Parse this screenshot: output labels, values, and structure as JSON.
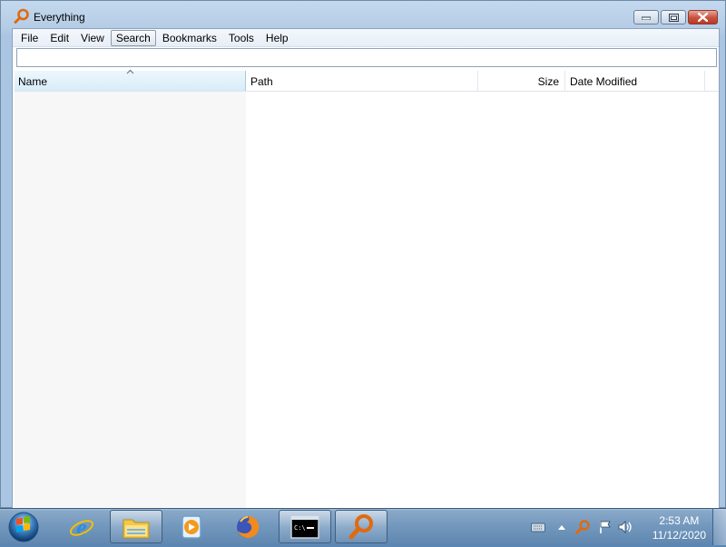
{
  "window": {
    "title": "Everything",
    "icon": "magnifier-icon"
  },
  "menu": {
    "items": [
      "File",
      "Edit",
      "View",
      "Search",
      "Bookmarks",
      "Tools",
      "Help"
    ],
    "active": "Search"
  },
  "search": {
    "value": "",
    "placeholder": ""
  },
  "list": {
    "columns": {
      "name": "Name",
      "path": "Path",
      "size": "Size",
      "date_modified": "Date Modified"
    },
    "sort_column": "name",
    "sort_direction": "ascending",
    "rows": []
  },
  "taskbar": {
    "start_icon": "windows-start-orb-icon",
    "apps": [
      {
        "name": "internet-explorer-icon",
        "active": false
      },
      {
        "name": "file-explorer-icon",
        "active": true
      },
      {
        "name": "media-player-icon",
        "active": false
      },
      {
        "name": "firefox-icon",
        "active": false
      },
      {
        "name": "command-prompt-icon",
        "active": true
      },
      {
        "name": "everything-search-icon",
        "active": true
      }
    ],
    "tray_icons": [
      "keyboard-icon",
      "show-hidden-icons-icon",
      "everything-tray-icon",
      "action-center-flag-icon",
      "volume-icon"
    ],
    "clock": {
      "time": "2:53 AM",
      "date": "11/12/2020"
    }
  },
  "colors": {
    "accent_orange": "#e06a0e",
    "taskbar_blue": "#7197bd",
    "selected_header": "#d7ecf8"
  }
}
